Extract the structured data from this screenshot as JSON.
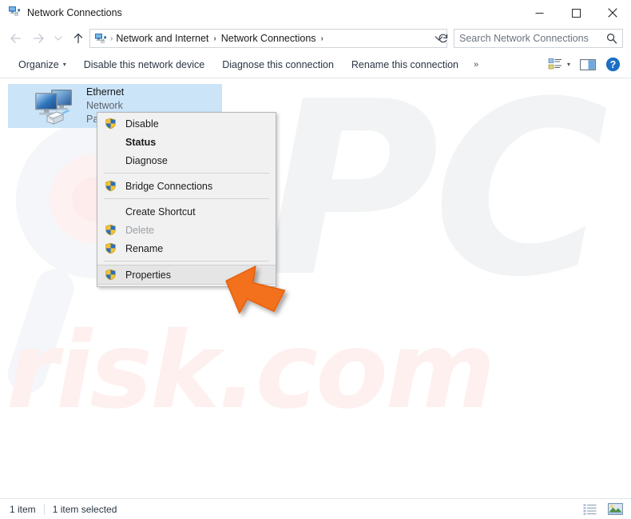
{
  "window": {
    "title": "Network Connections",
    "title_icon": "network-connections-icon",
    "controls": {
      "minimize": "minimize-button",
      "maximize": "maximize-button",
      "close": "close-button"
    }
  },
  "address_bar": {
    "back": "back-button",
    "forward": "forward-button",
    "recent": "recent-locations-button",
    "up": "up-button",
    "breadcrumb": [
      {
        "label": "Network and Internet"
      },
      {
        "label": "Network Connections"
      }
    ],
    "dropdown": "address-dropdown-button",
    "refresh": "refresh-button",
    "search": {
      "placeholder": "Search Network Connections",
      "value": ""
    }
  },
  "command_bar": {
    "items": [
      {
        "label": "Organize",
        "has_caret": true
      },
      {
        "label": "Disable this network device",
        "has_caret": false
      },
      {
        "label": "Diagnose this connection",
        "has_caret": false
      },
      {
        "label": "Rename this connection",
        "has_caret": false
      }
    ],
    "overflow": "»",
    "right_icons": [
      {
        "name": "change-view-icon",
        "has_caret": true
      },
      {
        "name": "preview-pane-icon",
        "has_caret": false
      },
      {
        "name": "help-icon",
        "has_caret": false
      }
    ]
  },
  "content": {
    "items": [
      {
        "name": "Ethernet",
        "sub1": "Network",
        "sub2": "Pa",
        "icon": "ethernet-adapter-icon",
        "selected": true
      }
    ]
  },
  "context_menu": {
    "items": [
      {
        "label": "Disable",
        "shield": true,
        "bold": false,
        "disabled": false,
        "highlight": false
      },
      {
        "label": "Status",
        "shield": false,
        "bold": true,
        "disabled": false,
        "highlight": false
      },
      {
        "label": "Diagnose",
        "shield": false,
        "bold": false,
        "disabled": false,
        "highlight": false
      },
      {
        "separator": true
      },
      {
        "label": "Bridge Connections",
        "shield": true,
        "bold": false,
        "disabled": false,
        "highlight": false
      },
      {
        "separator": true
      },
      {
        "label": "Create Shortcut",
        "shield": false,
        "bold": false,
        "disabled": false,
        "highlight": false
      },
      {
        "label": "Delete",
        "shield": true,
        "bold": false,
        "disabled": true,
        "highlight": false
      },
      {
        "label": "Rename",
        "shield": true,
        "bold": false,
        "disabled": false,
        "highlight": false
      },
      {
        "separator": true
      },
      {
        "label": "Properties",
        "shield": true,
        "bold": false,
        "disabled": false,
        "highlight": true
      }
    ]
  },
  "status_bar": {
    "item_count": "1 item",
    "selection": "1 item selected",
    "views": [
      {
        "name": "details-view-icon"
      },
      {
        "name": "large-icons-view-icon"
      }
    ]
  },
  "watermark": {
    "primary": "PC",
    "secondary": "risk.com"
  },
  "colors": {
    "selection": "#cce4f7",
    "accent": "#0078d7",
    "cursor": "#f3701b",
    "menu_bg": "#f1f1f1",
    "shield_blue": "#2a6fc0",
    "shield_gold": "#f5c234"
  }
}
